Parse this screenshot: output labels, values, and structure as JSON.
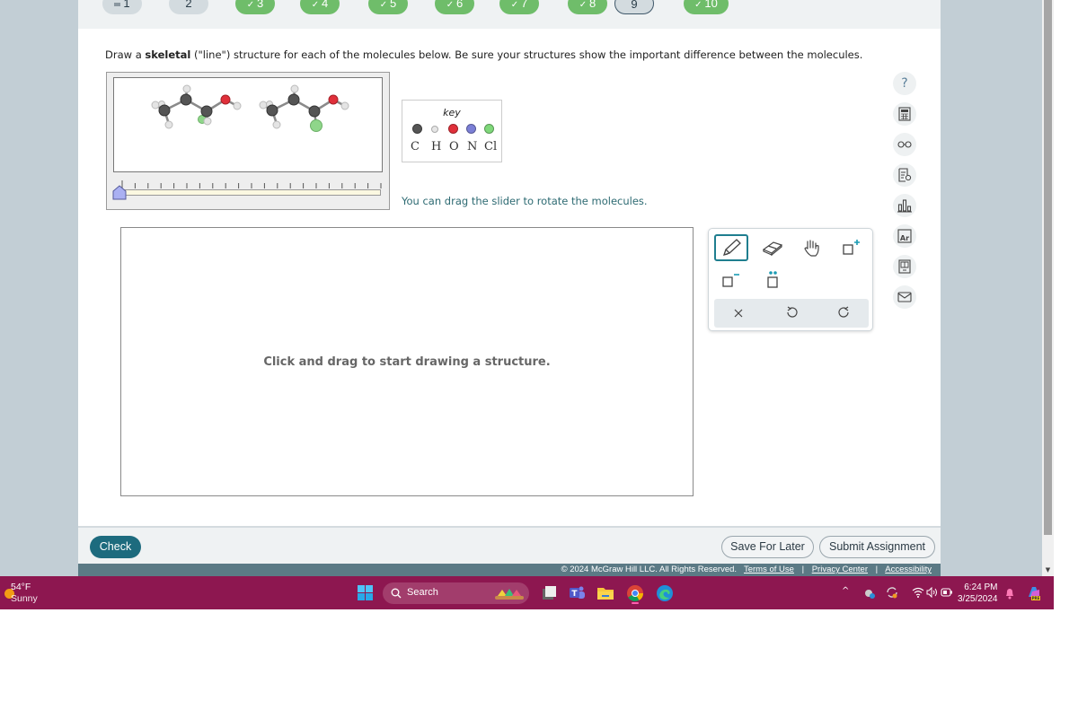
{
  "question_nav": {
    "items": [
      {
        "label": "1",
        "state": "flagged"
      },
      {
        "label": "2",
        "state": "todo"
      },
      {
        "label": "3",
        "state": "done"
      },
      {
        "label": "4",
        "state": "done"
      },
      {
        "label": "5",
        "state": "done"
      },
      {
        "label": "6",
        "state": "done"
      },
      {
        "label": "7",
        "state": "done"
      },
      {
        "label": "8",
        "state": "done"
      },
      {
        "label": "9",
        "state": "current"
      },
      {
        "label": "10",
        "state": "done"
      }
    ],
    "check_glyph": "✓"
  },
  "instructions": {
    "prefix": "Draw a ",
    "bold": "skeletal",
    "suffix": " (\"line\") structure for each of the molecules below. Be sure your structures show the important difference between the molecules."
  },
  "viewer": {
    "slider_position_fraction": 0.0,
    "tick_count": 21
  },
  "key": {
    "title": "key",
    "atoms": [
      {
        "symbol": "C",
        "color": "#555555"
      },
      {
        "symbol": "H",
        "color": "#e6e6e6"
      },
      {
        "symbol": "O",
        "color": "#e0303a"
      },
      {
        "symbol": "N",
        "color": "#7b7fd6"
      },
      {
        "symbol": "Cl",
        "color": "#7fd87a"
      }
    ]
  },
  "rotate_hint": "You can drag the slider to rotate the molecules.",
  "canvas": {
    "hint": "Click and drag to start drawing a structure."
  },
  "toolbox": {
    "tools": [
      {
        "name": "pencil",
        "selected": true
      },
      {
        "name": "eraser",
        "selected": false
      },
      {
        "name": "hand",
        "selected": false
      },
      {
        "name": "positive-charge",
        "selected": false
      },
      {
        "name": "negative-charge",
        "selected": false
      },
      {
        "name": "lone-pair",
        "selected": false
      }
    ],
    "actions": [
      "clear",
      "undo",
      "redo"
    ],
    "accent": "#1f7e8f"
  },
  "side_tools": [
    "help",
    "calculator",
    "reading-glasses",
    "hint",
    "chart",
    "periodic-table",
    "textbook",
    "message"
  ],
  "side_tools_text": {
    "periodic_table": "Ar",
    "help": "?"
  },
  "actions": {
    "check": "Check",
    "save": "Save For Later",
    "submit": "Submit Assignment"
  },
  "footer": {
    "copyright": "© 2024 McGraw Hill LLC. All Rights Reserved.",
    "terms": "Terms of Use",
    "privacy": "Privacy Center",
    "accessibility": "Accessibility",
    "separator": "|"
  },
  "taskbar": {
    "temperature": "54°F",
    "condition": "Sunny",
    "search": "Search",
    "time": "6:24 PM",
    "date": "3/25/2024",
    "color": "#8d1750"
  }
}
